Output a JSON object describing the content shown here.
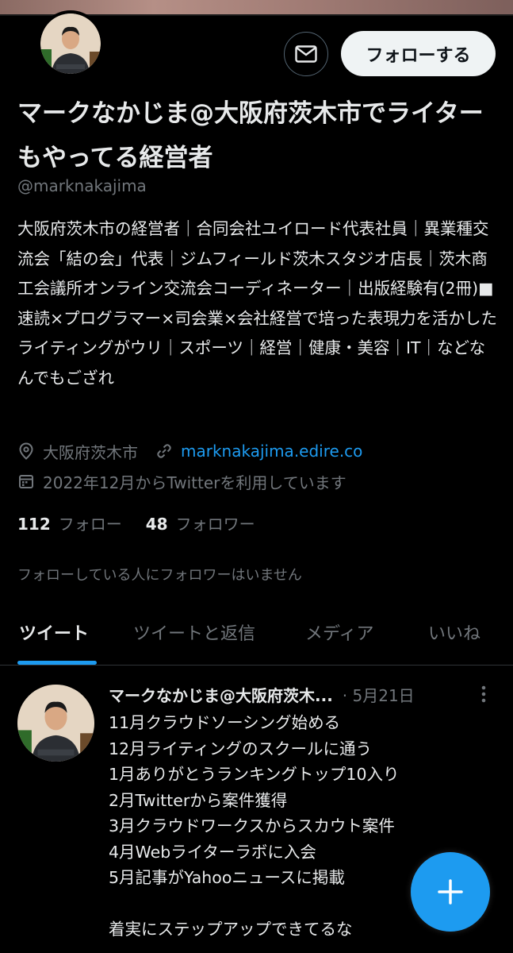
{
  "profile": {
    "name": "マークなかじま@大阪府茨木市でライターもやってる経営者",
    "handle": "@marknakajima",
    "bio": "大阪府茨木市の経営者｜合同会社ユイロード代表社員｜異業種交流会「結の会」代表｜ジムフィールド茨木スタジオ店長｜茨木商工会議所オンライン交流会コーディネーター｜出版経験有(2冊)■速読×プログラマー×司会業×会社経営で培った表現力を活かしたライティングがウリ｜スポーツ｜経営｜健康・美容｜IT｜などなんでもござれ",
    "location": "大阪府茨木市",
    "website": "marknakajima.edire.co",
    "joined": "2022年12月からTwitterを利用しています",
    "following_count": "112",
    "following_label": "フォロー",
    "followers_count": "48",
    "followers_label": "フォロワー",
    "no_mutual_followers": "フォローしている人にフォロワーはいません"
  },
  "actions": {
    "follow_label": "フォローする",
    "message_icon": "mail-icon"
  },
  "tabs": [
    {
      "label": "ツイート",
      "active": true
    },
    {
      "label": "ツイートと返信",
      "active": false
    },
    {
      "label": "メディア",
      "active": false
    },
    {
      "label": "いいね",
      "active": false
    }
  ],
  "tweet": {
    "author": "マークなかじま@大阪府茨木...",
    "date": "· 5月21日",
    "body": "11月クラウドソーシング始める\n12月ライティングのスクールに通う\n1月ありがとうランキングトップ10入り\n2月Twitterから案件獲得\n3月クラウドワークスからスカウト案件\n4月Webライターラボに入会\n5月記事がYahooニュースに掲載\n\n着実にステップアップできてるな"
  },
  "fab": {
    "icon": "plus-icon",
    "color": "#1d9bf0"
  },
  "colors": {
    "accent": "#1d9bf0",
    "muted": "#71767b",
    "text": "#e7e9ea",
    "background": "#000000"
  }
}
